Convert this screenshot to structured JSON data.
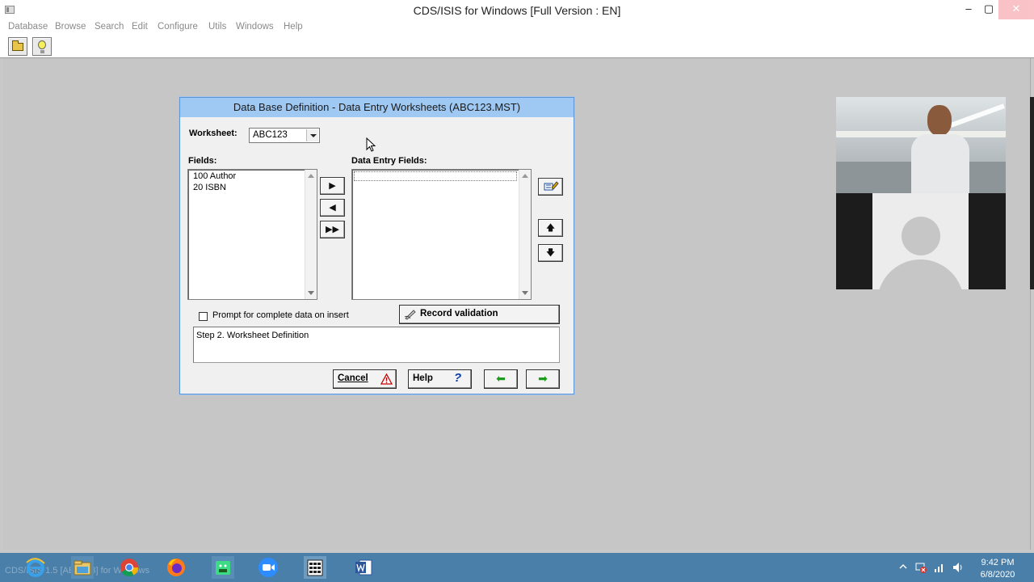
{
  "window": {
    "title": "CDS/ISIS for Windows [Full Version : EN]",
    "min_glyph": "–",
    "max_glyph": "▢",
    "close_glyph": "✕"
  },
  "menu": [
    "Database",
    "Browse",
    "Search",
    "Edit",
    "Configure",
    "Utils",
    "Windows",
    "Help"
  ],
  "toolbar": {
    "buttons": [
      "folder-open-icon",
      "lightbulb-icon"
    ]
  },
  "dialog": {
    "title": "Data Base Definition - Data Entry Worksheets (ABC123.MST)",
    "worksheet_label": "Worksheet:",
    "worksheet_value": "ABC123",
    "fields_label": "Fields:",
    "fields_items": [
      "100 Author",
      "20 ISBN"
    ],
    "data_entry_label": "Data Entry Fields:",
    "data_entry_items": [],
    "move_right_glyph": "▶",
    "move_left_glyph": "◀",
    "move_all_glyph": "▶▶",
    "move_up_glyph": "🡅",
    "move_down_glyph": "🡇",
    "checkbox_label": "Prompt for complete data on insert",
    "checkbox_checked": false,
    "record_validation_label": "Record validation",
    "step_text": "Step 2. Worksheet Definition",
    "cancel_label": "Cancel",
    "help_label": "Help",
    "help_glyph": "?",
    "back_glyph": "⬅",
    "next_glyph": "➡"
  },
  "taskbar": {
    "ghost_text": "CDS/ISIS 1.5 [ABC123] for Windows",
    "time": "9:42 PM",
    "date": "6/8/2020",
    "apps": [
      "internet-explorer-icon",
      "file-explorer-icon",
      "chrome-icon",
      "firefox-icon",
      "android-studio-icon",
      "zoom-icon",
      "cdsisis-icon",
      "word-icon"
    ]
  },
  "colors": {
    "dialog_title_bg": "#9fc8f2",
    "taskbar": "#4a7fa9",
    "workspace": "#c6c6c6",
    "arrow_green": "#1c9c1c"
  }
}
